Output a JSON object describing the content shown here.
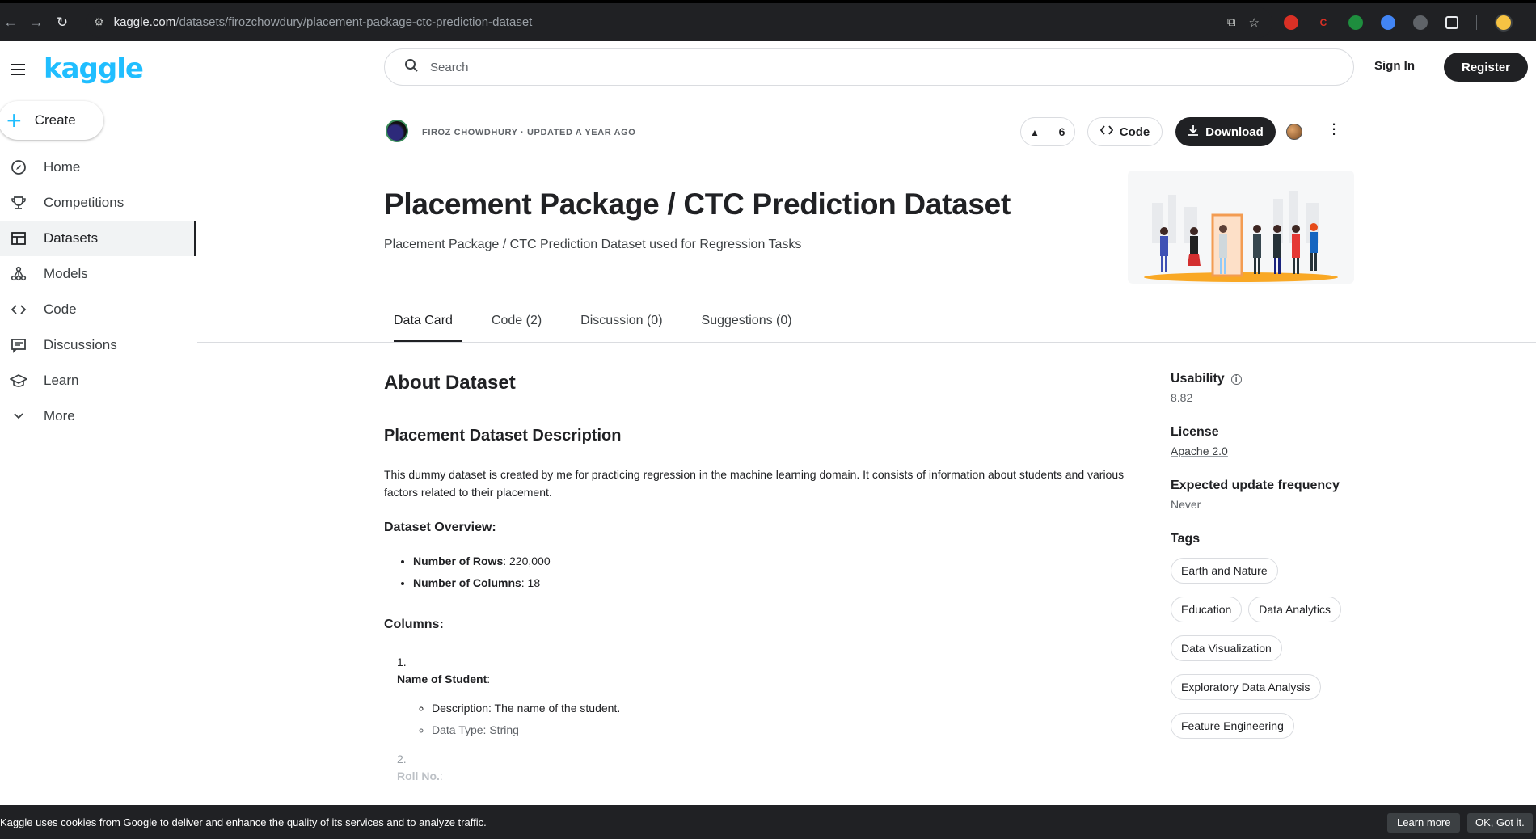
{
  "browser": {
    "url_host": "kaggle.com",
    "url_path": "/datasets/firozchowdury/placement-package-ctc-prediction-dataset"
  },
  "sidebar": {
    "logo": "kaggle",
    "create_label": "Create",
    "items": [
      {
        "label": "Home",
        "icon": "compass-icon"
      },
      {
        "label": "Competitions",
        "icon": "trophy-icon"
      },
      {
        "label": "Datasets",
        "icon": "table-icon"
      },
      {
        "label": "Models",
        "icon": "models-icon"
      },
      {
        "label": "Code",
        "icon": "code-icon"
      },
      {
        "label": "Discussions",
        "icon": "comments-icon"
      },
      {
        "label": "Learn",
        "icon": "school-icon"
      },
      {
        "label": "More",
        "icon": "chevron-down-icon"
      }
    ]
  },
  "header": {
    "search_placeholder": "Search",
    "signin_label": "Sign In",
    "register_label": "Register"
  },
  "dataset": {
    "owner_line": "FIROZ CHOWDHURY · UPDATED A YEAR AGO",
    "votes": "6",
    "code_label": "Code",
    "download_label": "Download",
    "title": "Placement Package / CTC Prediction Dataset",
    "subtitle": "Placement Package / CTC Prediction Dataset used for Regression Tasks"
  },
  "tabs": [
    {
      "label": "Data Card"
    },
    {
      "label": "Code (2)"
    },
    {
      "label": "Discussion (0)"
    },
    {
      "label": "Suggestions (0)"
    }
  ],
  "content": {
    "about_heading": "About Dataset",
    "desc_heading": "Placement Dataset Description",
    "desc_text": "This dummy dataset is created by me for practicing regression in the machine learning domain. It consists of information about students and various factors related to their placement.",
    "overview_heading": "Dataset Overview:",
    "overview": [
      {
        "key": "Number of Rows",
        "value": ": 220,000"
      },
      {
        "key": "Number of Columns",
        "value": ": 18"
      }
    ],
    "columns_heading": "Columns:",
    "col1_num": "1.",
    "col1_name": "Name of Student",
    "col1_colon": ":",
    "col1_desc": "Description: The name of the student.",
    "col1_type": "Data Type: String",
    "col2_num": "2.",
    "col2_name": "Roll No.",
    "col2_colon": ":"
  },
  "meta": {
    "usability_label": "Usability",
    "usability_value": "8.82",
    "license_label": "License",
    "license_value": "Apache 2.0",
    "frequency_label": "Expected update frequency",
    "frequency_value": "Never",
    "tags_label": "Tags",
    "tags": [
      "Earth and Nature",
      "Education",
      "Data Analytics",
      "Data Visualization",
      "Exploratory Data Analysis",
      "Feature Engineering"
    ]
  },
  "cookie": {
    "message": "Kaggle uses cookies from Google to deliver and enhance the quality of its services and to analyze traffic.",
    "learn_more": "Learn more",
    "ok": "OK, Got it."
  }
}
